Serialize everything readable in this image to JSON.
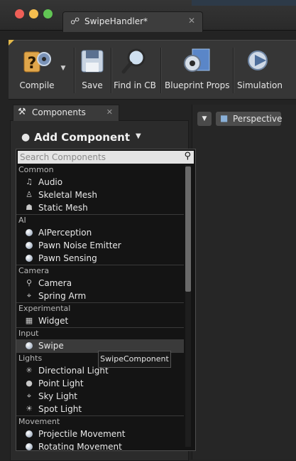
{
  "window": {
    "tab_title": "SwipeHandler*",
    "tab_icon": "blueprint-icon",
    "traffic_colors": [
      "#ee5f57",
      "#f5be4f",
      "#61c554"
    ]
  },
  "toolbar": {
    "compile": "Compile",
    "save": "Save",
    "find": "Find in CB",
    "props": "Blueprint Props",
    "simulation": "Simulation"
  },
  "components_panel": {
    "tab_label": "Components",
    "add_component": "Add Component",
    "search_placeholder": "Search Components"
  },
  "viewport": {
    "perspective": "Perspective"
  },
  "categories": [
    {
      "name": "Common",
      "items": [
        {
          "label": "Audio",
          "icon": "audio-icon"
        },
        {
          "label": "Skeletal Mesh",
          "icon": "skeletal-mesh-icon"
        },
        {
          "label": "Static Mesh",
          "icon": "static-mesh-icon"
        }
      ]
    },
    {
      "name": "AI",
      "items": [
        {
          "label": "AIPerception",
          "icon": "component-sphere-icon"
        },
        {
          "label": "Pawn Noise Emitter",
          "icon": "component-sphere-icon"
        },
        {
          "label": "Pawn Sensing",
          "icon": "component-sphere-icon"
        }
      ]
    },
    {
      "name": "Camera",
      "items": [
        {
          "label": "Camera",
          "icon": "camera-icon"
        },
        {
          "label": "Spring Arm",
          "icon": "spring-arm-icon"
        }
      ]
    },
    {
      "name": "Experimental",
      "items": [
        {
          "label": "Widget",
          "icon": "widget-icon"
        }
      ]
    },
    {
      "name": "Input",
      "items": [
        {
          "label": "Swipe",
          "icon": "component-sphere-icon"
        }
      ]
    },
    {
      "name": "Lights",
      "items": [
        {
          "label": "Directional Light",
          "icon": "directional-light-icon"
        },
        {
          "label": "Point Light",
          "icon": "point-light-icon"
        },
        {
          "label": "Sky Light",
          "icon": "sky-light-icon"
        },
        {
          "label": "Spot Light",
          "icon": "spot-light-icon"
        }
      ]
    },
    {
      "name": "Movement",
      "items": [
        {
          "label": "Projectile Movement",
          "icon": "component-sphere-icon"
        },
        {
          "label": "Rotating Movement",
          "icon": "component-sphere-icon"
        }
      ]
    }
  ],
  "tooltip": "SwipeComponent"
}
